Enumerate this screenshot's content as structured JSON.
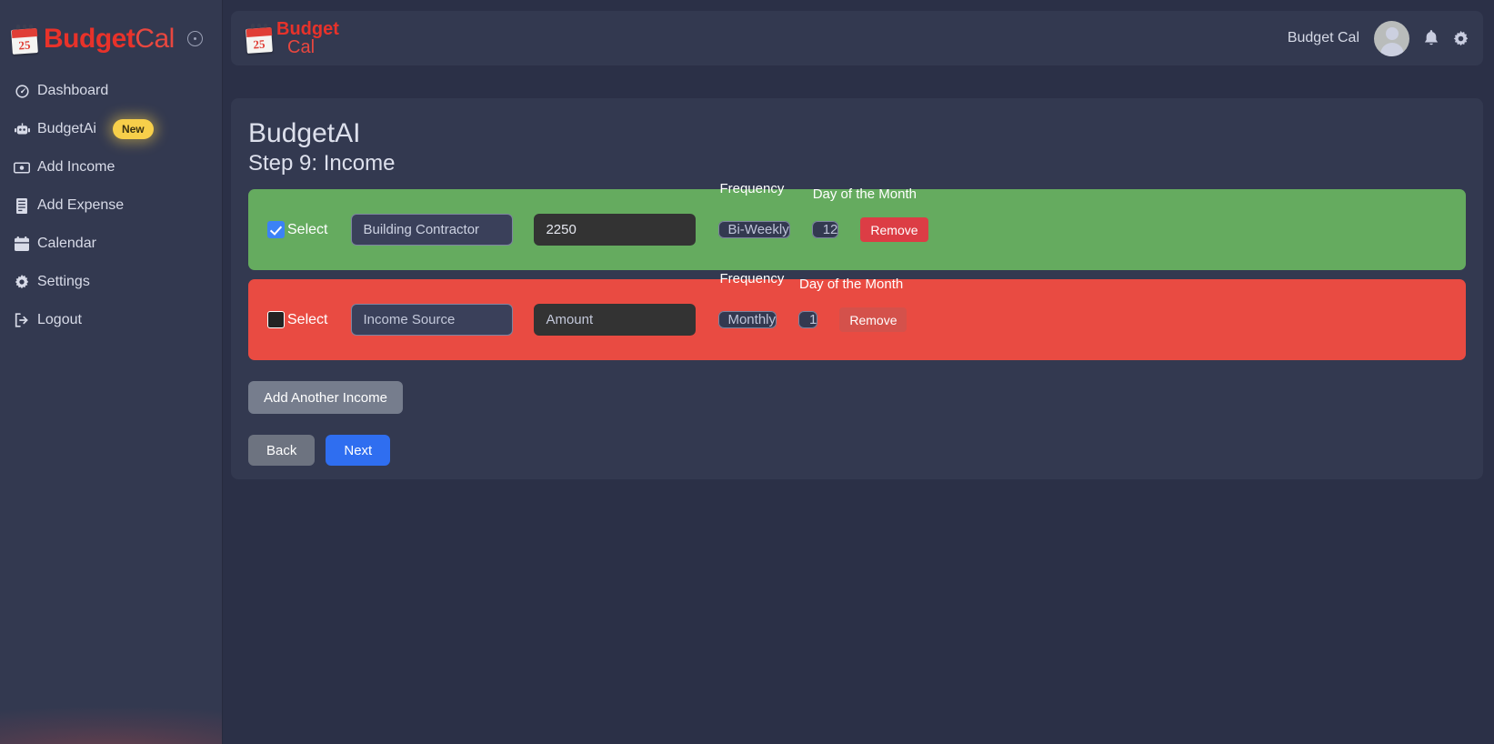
{
  "brand": {
    "name_bold": "Budget",
    "name_light": "Cal",
    "calendar_day": "25",
    "toggle_icon": "collapse-toggle-icon"
  },
  "sidebar": {
    "items": [
      {
        "label": "Dashboard",
        "icon": "dashboard-icon"
      },
      {
        "label": "BudgetAi",
        "icon": "robot-icon",
        "badge": "New"
      },
      {
        "label": "Add Income",
        "icon": "money-bill-icon"
      },
      {
        "label": "Add Expense",
        "icon": "receipt-icon"
      },
      {
        "label": "Calendar",
        "icon": "calendar-icon"
      },
      {
        "label": "Settings",
        "icon": "gear-icon"
      },
      {
        "label": "Logout",
        "icon": "logout-icon"
      }
    ]
  },
  "topbar": {
    "logo_line1": "Budget",
    "logo_line2": "Cal",
    "user_name": "Budget Cal",
    "avatar_icon": "user-avatar",
    "bell_icon": "notification-bell-icon",
    "gear_icon": "settings-gear-icon"
  },
  "main": {
    "title": "BudgetAI",
    "step_title": "Step 9: Income",
    "labels": {
      "select": "Select",
      "frequency": "Frequency",
      "day_of_month": "Day of the Month",
      "remove": "Remove"
    },
    "rows": [
      {
        "state": "green",
        "checked": true,
        "source_value": "Building Contractor",
        "source_placeholder": "Income Source",
        "amount_value": "2250",
        "amount_placeholder": "Amount",
        "frequency_value": "Bi-Weekly",
        "day_value": "12"
      },
      {
        "state": "red",
        "checked": false,
        "source_value": "",
        "source_placeholder": "Income Source",
        "amount_value": "",
        "amount_placeholder": "Amount",
        "frequency_value": "Monthly",
        "day_value": "1"
      }
    ],
    "add_another_label": "Add Another Income",
    "back_label": "Back",
    "next_label": "Next"
  },
  "colors": {
    "page_bg": "#2b3047",
    "panel_bg": "#333950",
    "brand_red": "#e8322a",
    "row_green": "#65ab5f",
    "row_red": "#e94b42",
    "accent_blue": "#2f6ef0",
    "badge_yellow": "#f7cf4a"
  }
}
